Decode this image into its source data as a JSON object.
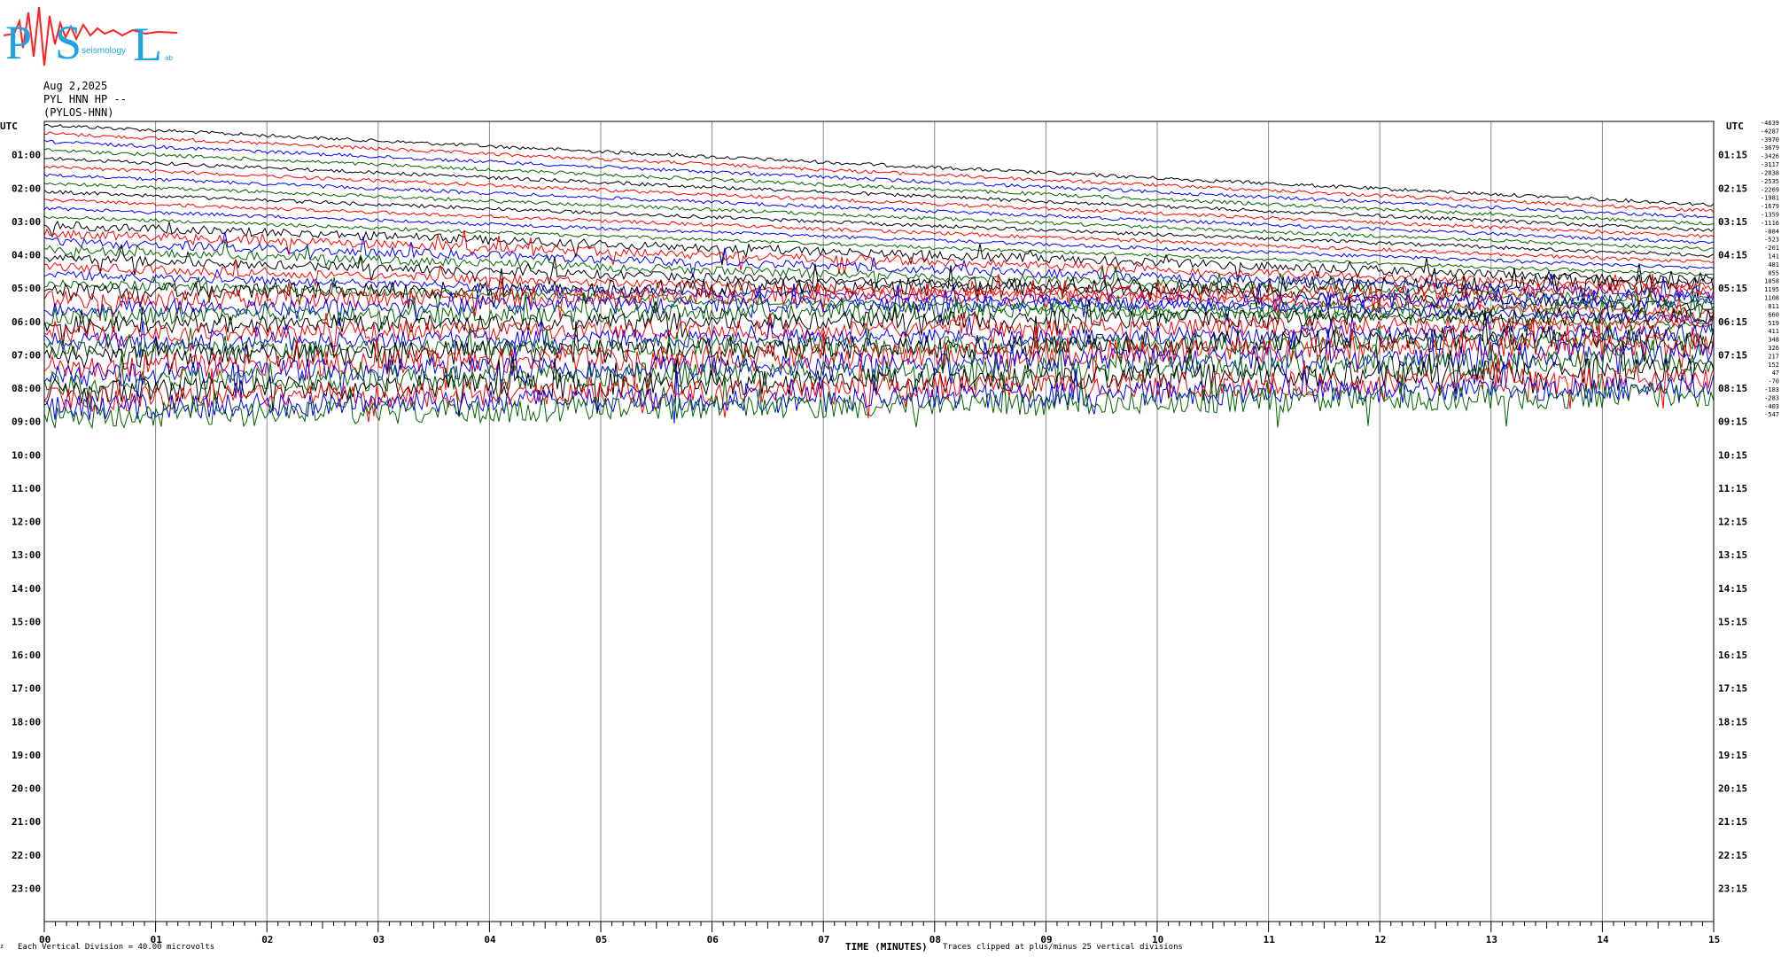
{
  "header": {
    "date": "Aug 2,2025",
    "station": "PYL HNN HP --",
    "station_name": "(PYLOS-HNN)"
  },
  "logo": {
    "letters": [
      "P",
      "S",
      "L"
    ],
    "subtitle": "seismology",
    "suffix": "ab"
  },
  "chart_data": {
    "type": "line",
    "title": "Aug 2,2025 PYL HNN HP -- (PYLOS-HNN)",
    "xlabel": "TIME (MINUTES)",
    "ylabel": "UTC",
    "x_ticks": [
      "00",
      "01",
      "02",
      "03",
      "04",
      "05",
      "06",
      "07",
      "08",
      "09",
      "10",
      "11",
      "12",
      "13",
      "14",
      "15"
    ],
    "xlim": [
      0,
      15
    ],
    "left_labels": [
      "01:00",
      "02:00",
      "03:00",
      "04:00",
      "05:00",
      "06:00",
      "07:00",
      "08:00",
      "09:00",
      "10:00",
      "11:00",
      "12:00",
      "13:00",
      "14:00",
      "15:00",
      "16:00",
      "17:00",
      "18:00",
      "19:00",
      "20:00",
      "21:00",
      "22:00",
      "23:00"
    ],
    "right_labels": [
      "01:15",
      "02:15",
      "03:15",
      "04:15",
      "05:15",
      "06:15",
      "07:15",
      "08:15",
      "09:15",
      "10:15",
      "11:15",
      "12:15",
      "13:15",
      "14:15",
      "15:15",
      "16:15",
      "17:15",
      "18:15",
      "19:15",
      "20:15",
      "21:15",
      "22:15",
      "23:15"
    ],
    "trace_offsets": [
      "-4639",
      "-4287",
      "-3970",
      "-3679",
      "-3426",
      "-3117",
      "-2838",
      "-2535",
      "-2269",
      "-1981",
      "-1679",
      "-1359",
      "-1116",
      "-884",
      "-523",
      "-201",
      "141",
      "481",
      "855",
      "1058",
      "1195",
      "1108",
      "811",
      "660",
      "519",
      "411",
      "348",
      "326",
      "217",
      "152",
      "47",
      "-70",
      "-183",
      "-283",
      "-403",
      "-547"
    ],
    "trace_colors": [
      "#000000",
      "#ff0000",
      "#0000ff",
      "#006400"
    ],
    "trace_count": 36,
    "traces_recorded_until": "09:00",
    "footer_left": "Each Vertical Division =   40.00 microvolts",
    "footer_right": "Traces clipped at plus/minus 25 vertical divisions",
    "grid": true
  },
  "left_corner_mark": "z"
}
